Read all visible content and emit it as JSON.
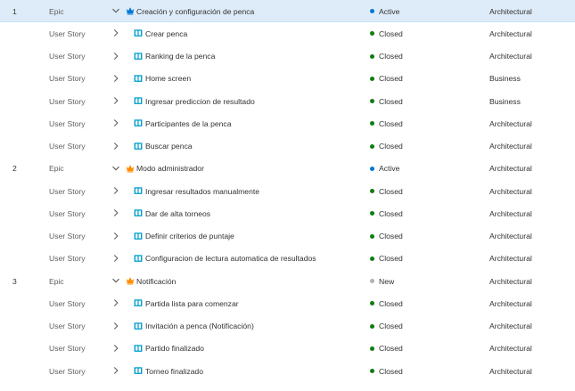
{
  "colors": {
    "epic_icon_active": "#0078d4",
    "epic_icon": "#ff8c00",
    "story_icon": "#009ccc",
    "state_active": "#0078d4",
    "state_closed": "#107c10",
    "state_new": "#b2b2b2",
    "selected_row_bg": "#deecf9",
    "chevron": "#605e5c"
  },
  "icons": {
    "epic": "crown-icon",
    "user_story": "book-icon",
    "expanded": "chevron-down-icon",
    "collapsed": "chevron-right-icon"
  },
  "rows": [
    {
      "order": "1",
      "type": "Epic",
      "title": "Creación y configuración de penca",
      "state": "Active",
      "value_area": "Architectural"
    },
    {
      "order": "",
      "type": "User Story",
      "title": "Crear penca",
      "state": "Closed",
      "value_area": "Architectural"
    },
    {
      "order": "",
      "type": "User Story",
      "title": "Ranking de la penca",
      "state": "Closed",
      "value_area": "Architectural"
    },
    {
      "order": "",
      "type": "User Story",
      "title": "Home screen",
      "state": "Closed",
      "value_area": "Business"
    },
    {
      "order": "",
      "type": "User Story",
      "title": "Ingresar prediccion de resultado",
      "state": "Closed",
      "value_area": "Business"
    },
    {
      "order": "",
      "type": "User Story",
      "title": "Participantes de la penca",
      "state": "Closed",
      "value_area": "Architectural"
    },
    {
      "order": "",
      "type": "User Story",
      "title": "Buscar penca",
      "state": "Closed",
      "value_area": "Architectural"
    },
    {
      "order": "2",
      "type": "Epic",
      "title": "Modo administrador",
      "state": "Active",
      "value_area": "Architectural"
    },
    {
      "order": "",
      "type": "User Story",
      "title": "Ingresar resultados manualmente",
      "state": "Closed",
      "value_area": "Architectural"
    },
    {
      "order": "",
      "type": "User Story",
      "title": "Dar de alta torneos",
      "state": "Closed",
      "value_area": "Architectural"
    },
    {
      "order": "",
      "type": "User Story",
      "title": "Definir criterios de puntaje",
      "state": "Closed",
      "value_area": "Architectural"
    },
    {
      "order": "",
      "type": "User Story",
      "title": "Configuracion de lectura automatica de resultados",
      "state": "Closed",
      "value_area": "Architectural"
    },
    {
      "order": "3",
      "type": "Epic",
      "title": "Notificación",
      "state": "New",
      "value_area": "Architectural"
    },
    {
      "order": "",
      "type": "User Story",
      "title": "Partida lista para comenzar",
      "state": "Closed",
      "value_area": "Architectural"
    },
    {
      "order": "",
      "type": "User Story",
      "title": "Invitación a penca (Notificación)",
      "state": "Closed",
      "value_area": "Architectural"
    },
    {
      "order": "",
      "type": "User Story",
      "title": "Partido finalizado",
      "state": "Closed",
      "value_area": "Architectural"
    },
    {
      "order": "",
      "type": "User Story",
      "title": "Torneo finalizado",
      "state": "Closed",
      "value_area": "Architectural"
    }
  ]
}
